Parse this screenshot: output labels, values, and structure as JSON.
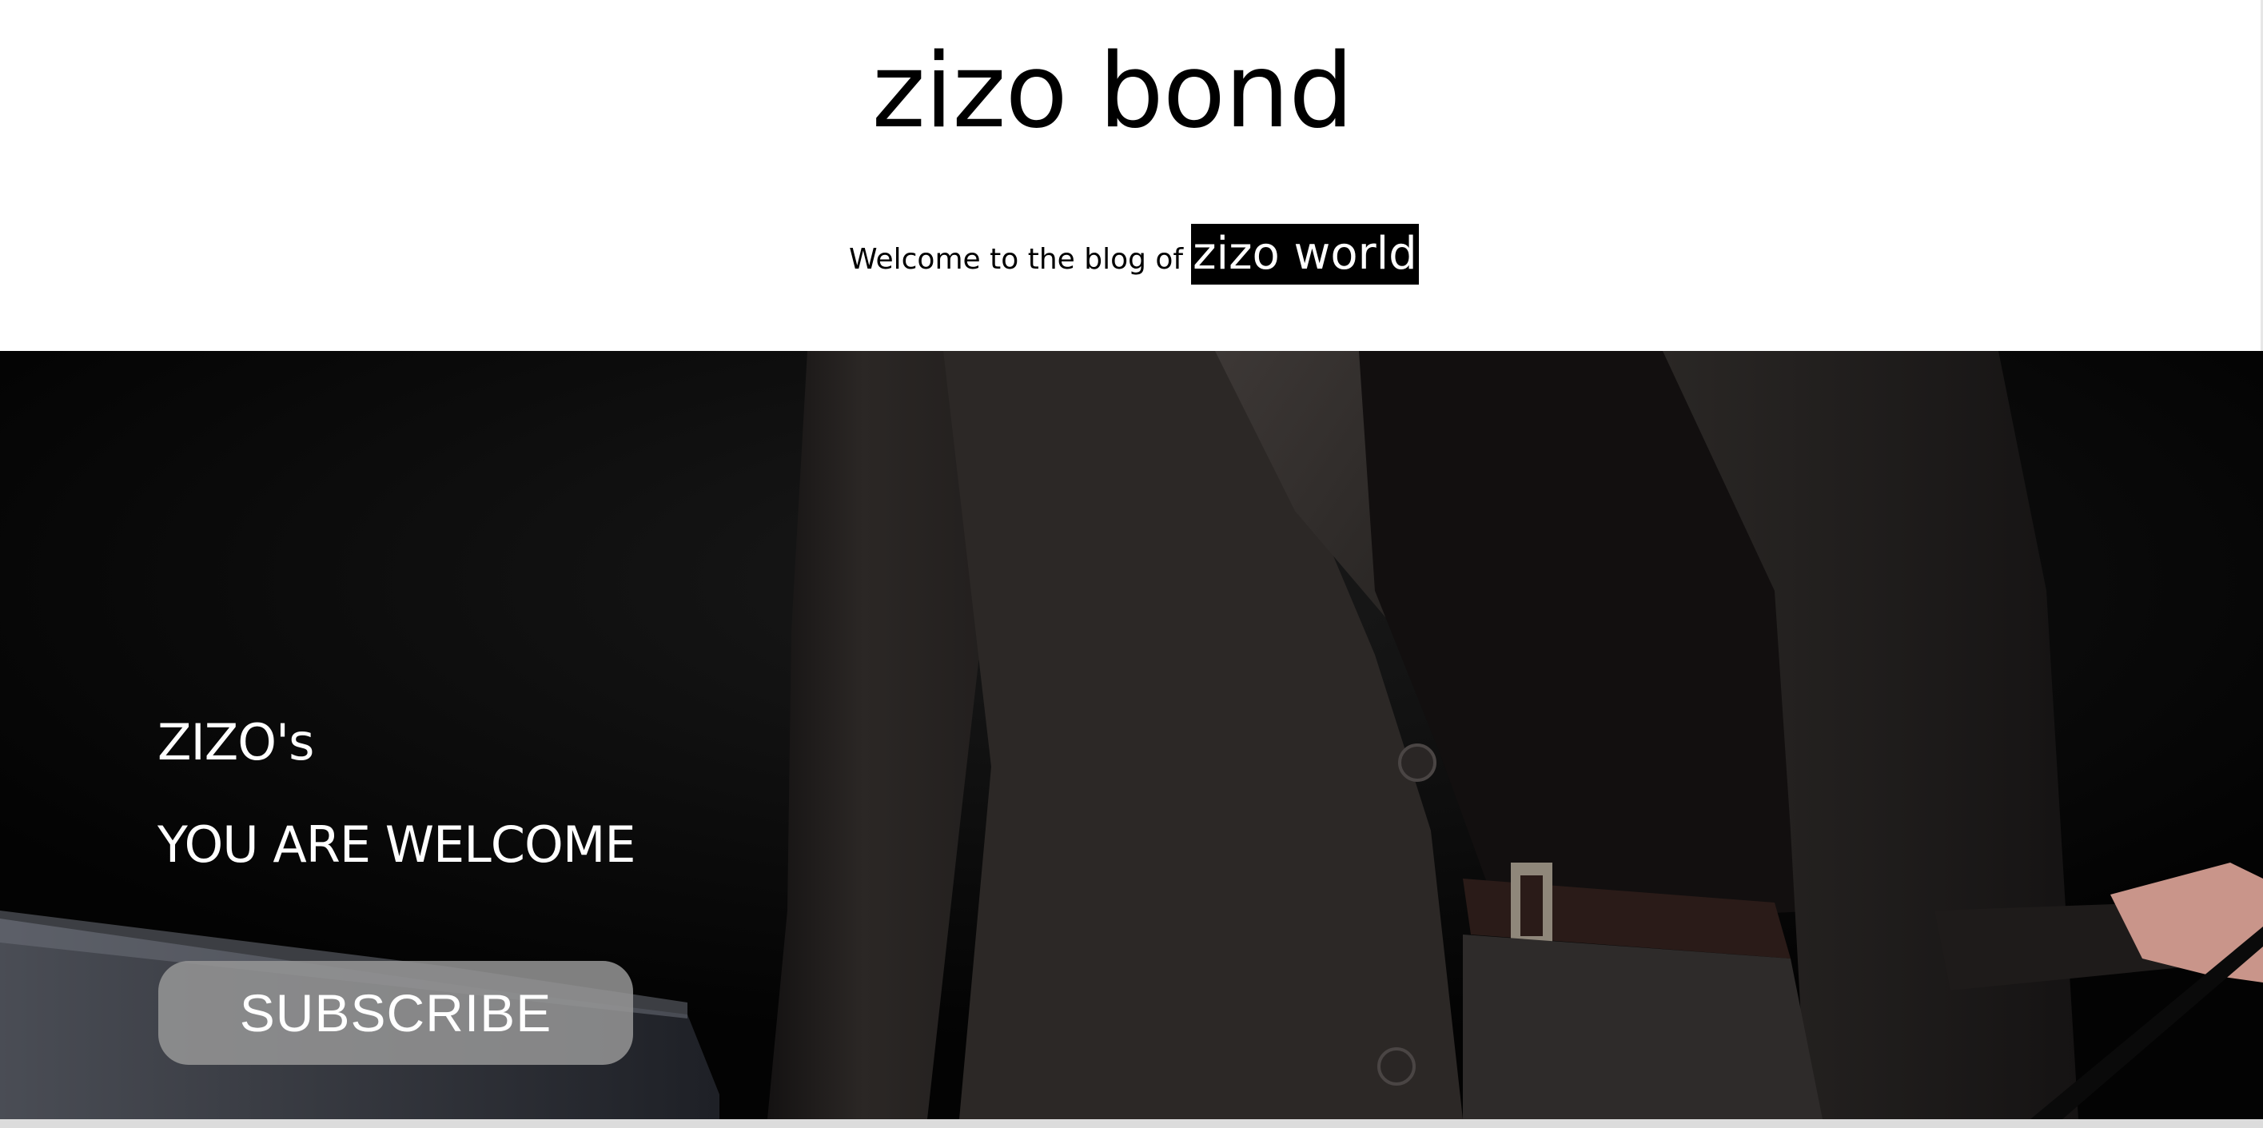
{
  "header": {
    "site_title": "zizo bond",
    "tagline_text": "Welcome to the blog of",
    "tagline_highlight": "zizo world"
  },
  "hero": {
    "heading_1": "ZIZO's",
    "heading_2": "YOU ARE WELCOME",
    "subscribe_label": "SUBSCRIBE",
    "background_image": "man-in-dark-suit-photo"
  },
  "colors": {
    "page_background": "#ffffff",
    "hero_background": "#030303",
    "highlight_background": "#000000",
    "highlight_text": "#ffffff",
    "button_background": "#969696"
  }
}
